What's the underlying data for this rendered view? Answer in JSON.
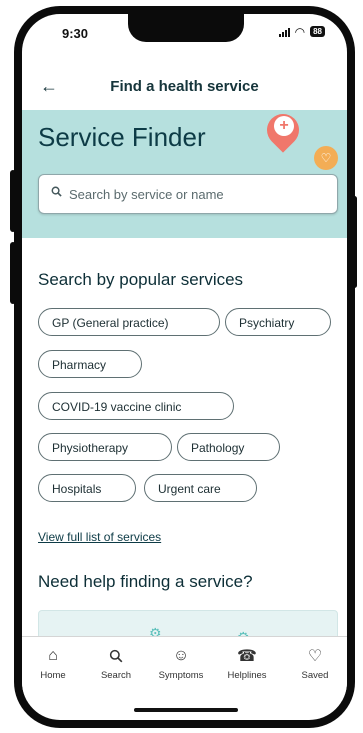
{
  "status_bar": {
    "time": "9:30",
    "battery": "88"
  },
  "app_bar": {
    "title": "Find a health service"
  },
  "hero": {
    "title": "Service Finder",
    "search_placeholder": "Search by service or name"
  },
  "popular": {
    "title": "Search by popular services",
    "services": [
      "GP (General practice)",
      "Psychiatry",
      "Pharmacy",
      "COVID-19 vaccine clinic",
      "Physiotherapy",
      "Pathology",
      "Hospitals",
      "Urgent care"
    ]
  },
  "view_all_link": "View full list of services",
  "help": {
    "title": "Need help finding a service?"
  },
  "tab_bar": {
    "tabs": [
      {
        "label": "Home",
        "icon": "home-icon"
      },
      {
        "label": "Search",
        "icon": "search-icon"
      },
      {
        "label": "Symptoms",
        "icon": "symptoms-icon"
      },
      {
        "label": "Helplines",
        "icon": "phone-icon"
      },
      {
        "label": "Saved",
        "icon": "heart-icon"
      }
    ]
  },
  "colors": {
    "hero_bg": "#b6e0de",
    "primary_text": "#0d3b46",
    "pin": "#f0776b",
    "badge": "#f3ad55"
  }
}
